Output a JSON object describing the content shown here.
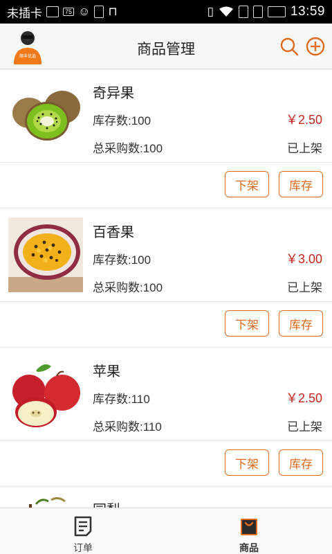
{
  "statusbar": {
    "carrier": "未插卡",
    "battery_badge": "75",
    "time": "13:59",
    "icons": [
      "image-icon",
      "battery-badge-icon",
      "smiley-icon",
      "usb-icon",
      "android-icon",
      "vibrate-icon",
      "wifi-icon",
      "sim-icon",
      "sim-icon",
      "battery-icon"
    ]
  },
  "header": {
    "title": "商品管理",
    "avatar_text": "顺丰优选",
    "accent": "#e06a1c"
  },
  "products": [
    {
      "name": "奇异果",
      "stock_label": "库存数:100",
      "price": "￥2.50",
      "bought_label": "总采购数:100",
      "status": "已上架",
      "off_label": "下架",
      "stock_btn": "库存",
      "image": "kiwi"
    },
    {
      "name": "百香果",
      "stock_label": "库存数:100",
      "price": "￥3.00",
      "bought_label": "总采购数:100",
      "status": "已上架",
      "off_label": "下架",
      "stock_btn": "库存",
      "image": "passion-fruit"
    },
    {
      "name": "苹果",
      "stock_label": "库存数:110",
      "price": "￥2.50",
      "bought_label": "总采购数:110",
      "status": "已上架",
      "off_label": "下架",
      "stock_btn": "库存",
      "image": "apple"
    }
  ],
  "partial_item": {
    "name": "园梨"
  },
  "nav": {
    "orders_label": "订单",
    "goods_label": "商品",
    "active": "商品"
  },
  "colors": {
    "price": "#c3261f",
    "accent": "#e06a1c",
    "active_tab": "#e06a1c"
  }
}
